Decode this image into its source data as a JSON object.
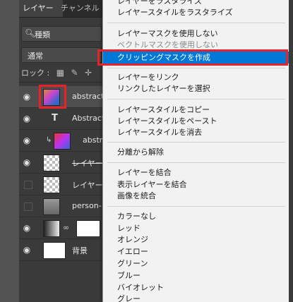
{
  "panel": {
    "tabs": [
      "レイヤー",
      "チャンネル"
    ],
    "search_label": "種類",
    "blend_mode": "通常",
    "lock_label": "ロック :",
    "layers": [
      {
        "name": "abstract",
        "kind": "smart",
        "visible": true,
        "selected": true
      },
      {
        "name": "Abstract",
        "kind": "text",
        "visible": true
      },
      {
        "name": "abstr",
        "kind": "clipped-smart",
        "visible": true
      },
      {
        "name": "レイヤー",
        "kind": "pixel",
        "visible": true
      },
      {
        "name": "レイヤー",
        "kind": "pixel",
        "visible": false
      },
      {
        "name": "person-",
        "kind": "smart",
        "visible": false
      },
      {
        "name": "",
        "kind": "adjustment",
        "visible": true
      },
      {
        "name": "背景",
        "kind": "background",
        "visible": true
      }
    ]
  },
  "menu": {
    "items": [
      {
        "label": "レイヤーをラスタライズ",
        "enabled": true
      },
      {
        "label": "レイヤースタイルをラスタライズ",
        "enabled": true
      },
      {
        "label": "レイヤーマスクを使用しない",
        "enabled": true
      },
      {
        "label": "ベクトルマスクを使用しない",
        "enabled": false
      },
      {
        "label": "クリッピングマスクを作成",
        "enabled": true,
        "highlighted": true
      },
      {
        "label": "レイヤーをリンク",
        "enabled": true
      },
      {
        "label": "リンクしたレイヤーを選択",
        "enabled": true
      },
      {
        "label": "レイヤースタイルをコピー",
        "enabled": true
      },
      {
        "label": "レイヤースタイルをペースト",
        "enabled": true
      },
      {
        "label": "レイヤースタイルを消去",
        "enabled": true
      },
      {
        "label": "分離から解除",
        "enabled": true
      },
      {
        "label": "レイヤーを結合",
        "enabled": true
      },
      {
        "label": "表示レイヤーを結合",
        "enabled": true
      },
      {
        "label": "画像を統合",
        "enabled": true
      },
      {
        "label": "カラーなし",
        "enabled": true
      },
      {
        "label": "レッド",
        "enabled": true
      },
      {
        "label": "オレンジ",
        "enabled": true
      },
      {
        "label": "イエロー",
        "enabled": true
      },
      {
        "label": "グリーン",
        "enabled": true
      },
      {
        "label": "ブルー",
        "enabled": true
      },
      {
        "label": "バイオレット",
        "enabled": true
      },
      {
        "label": "グレー",
        "enabled": true
      }
    ]
  },
  "colors": {
    "highlight": "#0078d7",
    "annotation_red": "#e8212a"
  }
}
